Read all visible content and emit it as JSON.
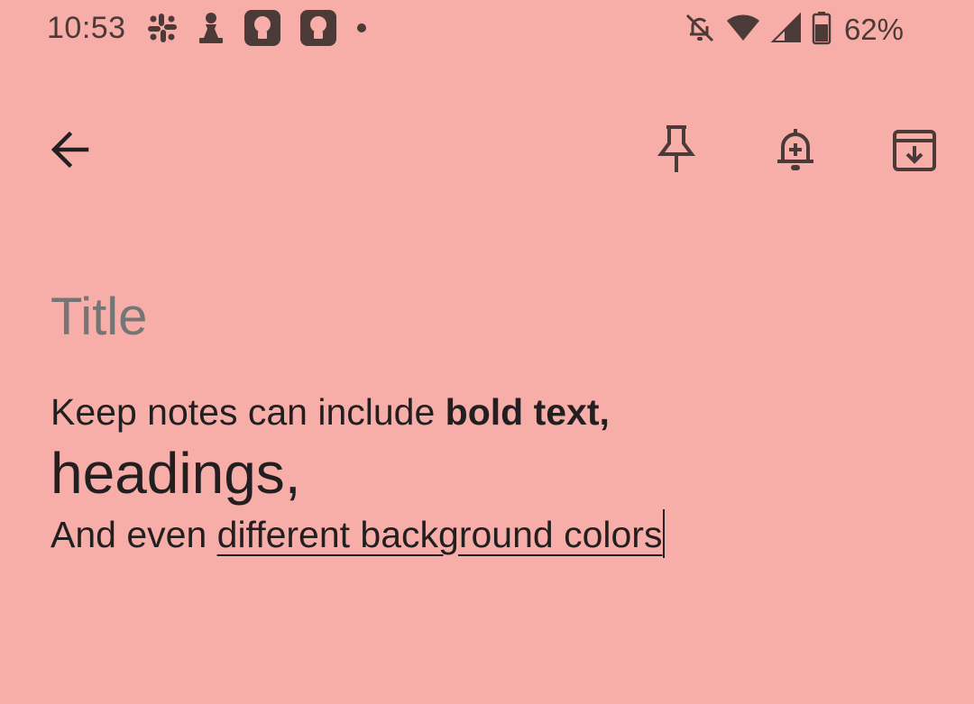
{
  "status_bar": {
    "time": "10:53",
    "battery_percent": "62%",
    "left_icons": [
      "slack-icon",
      "chess-pawn-icon",
      "keep-icon",
      "keep-icon",
      "notification-dot-icon"
    ],
    "right_icons": [
      "notifications-off-icon",
      "wifi-icon",
      "cell-signal-icon",
      "battery-icon"
    ]
  },
  "toolbar": {
    "back_icon": "back-arrow-icon",
    "pin_icon": "pin-icon",
    "reminder_icon": "add-reminder-icon",
    "archive_icon": "archive-icon"
  },
  "note": {
    "title_placeholder": "Title",
    "title_value": "",
    "body": {
      "line1_plain": "Keep notes can include ",
      "line1_bold": "bold text,",
      "heading": "headings,",
      "line3_plain": "And even ",
      "line3_underlined": "different background colors"
    },
    "background_color": "#F7AEA8"
  }
}
